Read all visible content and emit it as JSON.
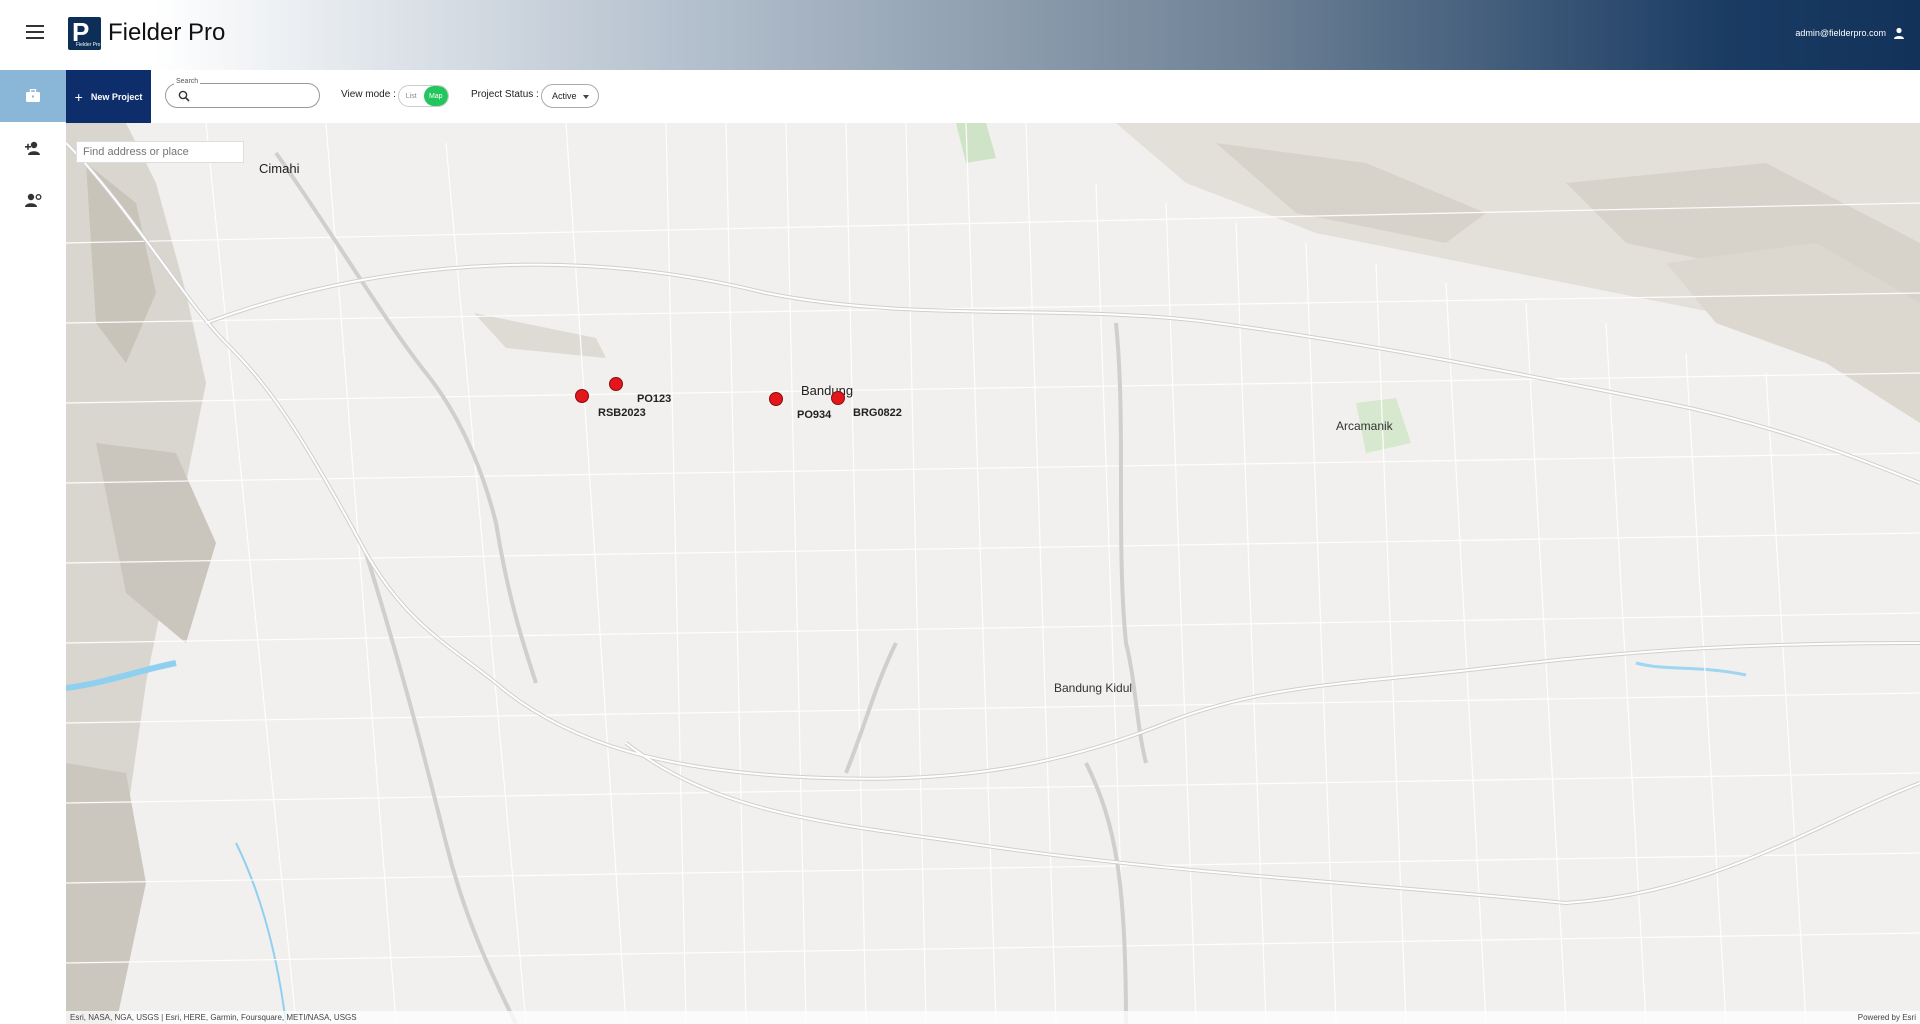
{
  "header": {
    "app_title": "Fielder Pro",
    "logo_caption": "Fielder Pro",
    "user_email": "admin@fielderpro.com"
  },
  "rail": {
    "items": [
      {
        "icon": "briefcase-icon",
        "active": true
      },
      {
        "icon": "add-person-icon",
        "active": false
      },
      {
        "icon": "manage-accounts-icon",
        "active": false
      }
    ]
  },
  "toolbar": {
    "new_project_label": "New Project",
    "search_label": "Search",
    "search_value": "",
    "view_mode_label": "View mode :",
    "view_mode_options": [
      "List",
      "Map"
    ],
    "view_mode_selected": "Map",
    "project_status_label": "Project Status :",
    "project_status_value": "Active"
  },
  "map": {
    "search_placeholder": "Find address or place",
    "places": [
      {
        "label": "Cimahi"
      },
      {
        "label": "Bandung"
      },
      {
        "label": "Arcamanik"
      },
      {
        "label": "Bandung Kidul"
      }
    ],
    "projects": [
      {
        "code": "RSB2023"
      },
      {
        "code": "PO123"
      },
      {
        "code": "PO934"
      },
      {
        "code": "BRG0822"
      }
    ],
    "attribution": "Esri, NASA, NGA, USGS | Esri, HERE, Garmin, Foursquare, METI/NASA, USGS",
    "powered_by": "Powered by Esri"
  },
  "colors": {
    "primary": "#0d2e6b",
    "accent_green": "#22c55e",
    "marker_red": "#e3161b",
    "rail_active": "#8ab6d8"
  }
}
